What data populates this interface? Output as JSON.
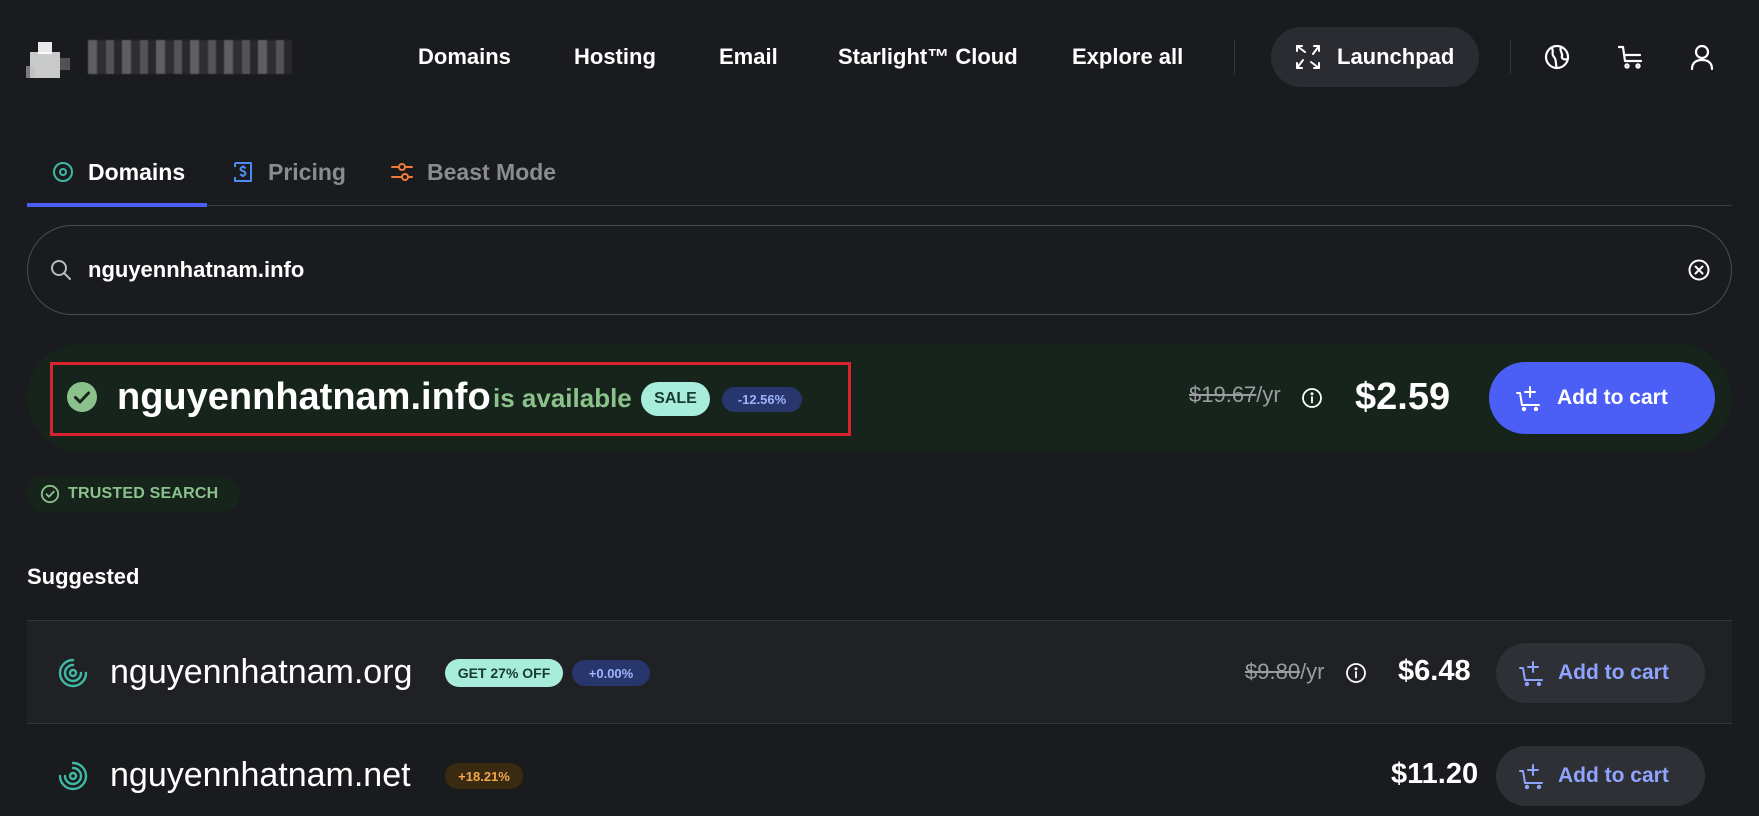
{
  "nav": {
    "links": [
      "Domains",
      "Hosting",
      "Email",
      "Starlight",
      "Explore all"
    ],
    "starlight_suffix": "™ Cloud",
    "launchpad_label": "Launchpad",
    "icons": [
      "globe-icon",
      "cart-icon",
      "user-icon"
    ]
  },
  "tabs": [
    {
      "label": "Domains",
      "icon": "target-icon",
      "active": true
    },
    {
      "label": "Pricing",
      "icon": "dollar-icon",
      "active": false
    },
    {
      "label": "Beast Mode",
      "icon": "sliders-icon",
      "active": false
    }
  ],
  "search": {
    "value": "nguyennhatnam.info"
  },
  "result": {
    "domain": "nguyennhatnam.info",
    "status": "is available",
    "sale_badge": "SALE",
    "discount_badge": "-12.56%",
    "old_price": "$19.67",
    "per": "/yr",
    "price": "$2.59",
    "cart_label": "Add to cart"
  },
  "trusted": {
    "label": "TRUSTED SEARCH"
  },
  "suggested": {
    "title": "Suggested",
    "items": [
      {
        "domain": "nguyennhatnam.org",
        "offer_badge": "GET 27% OFF",
        "change_badge": "+0.00%",
        "old_price": "$9.80",
        "per": "/yr",
        "price": "$6.48",
        "cart_label": "Add to cart"
      },
      {
        "domain": "nguyennhatnam.net",
        "change_badge": "+18.21%",
        "price": "$11.20",
        "cart_label": "Add to cart"
      }
    ]
  },
  "colors": {
    "background": "#1a1b1e",
    "accent": "#4b5ef5",
    "success": "#8bc28b",
    "highlight": "#d9232e",
    "offer_badge": "#a8ecdc"
  }
}
